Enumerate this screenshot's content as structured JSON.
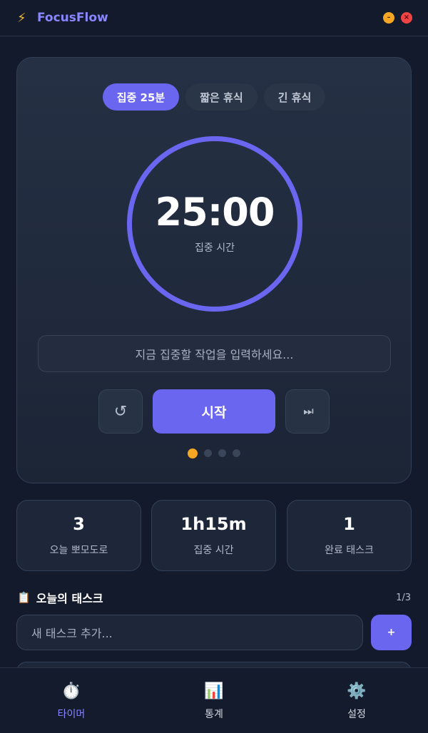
{
  "app": {
    "title": "FocusFlow",
    "icon": "lightning-icon"
  },
  "window": {
    "minimize_symbol": "–",
    "close_symbol": "×"
  },
  "timer": {
    "modes": [
      {
        "label": "집중 25분",
        "active": true
      },
      {
        "label": "짧은 휴식",
        "active": false
      },
      {
        "label": "긴 휴식",
        "active": false
      }
    ],
    "time": "25:00",
    "label": "집중 시간",
    "progress": 1.0,
    "task_placeholder": "지금 집중할 작업을 입력하세요...",
    "reset_icon": "↺",
    "start_label": "시작",
    "skip_icon": "⏭",
    "session_dots": {
      "total": 4,
      "current": 1
    }
  },
  "stats": [
    {
      "value": "3",
      "label": "오늘 뽀모도로"
    },
    {
      "value": "1h15m",
      "label": "집중 시간"
    },
    {
      "value": "1",
      "label": "완료 태스크"
    }
  ],
  "tasks": {
    "title": "오늘의 태스크",
    "title_icon": "clipboard-icon",
    "count": "1/3",
    "input_placeholder": "새 태스크 추가...",
    "add_symbol": "+"
  },
  "nav": [
    {
      "label": "타이머",
      "icon": "stopwatch-icon",
      "active": true
    },
    {
      "label": "통계",
      "icon": "bar-chart-icon",
      "active": false
    },
    {
      "label": "설정",
      "icon": "gear-icon",
      "active": false
    }
  ],
  "colors": {
    "accent": "#6b66f0",
    "brand": "#8a86ff",
    "background": "#121a2b",
    "session_active": "#f5a623"
  }
}
